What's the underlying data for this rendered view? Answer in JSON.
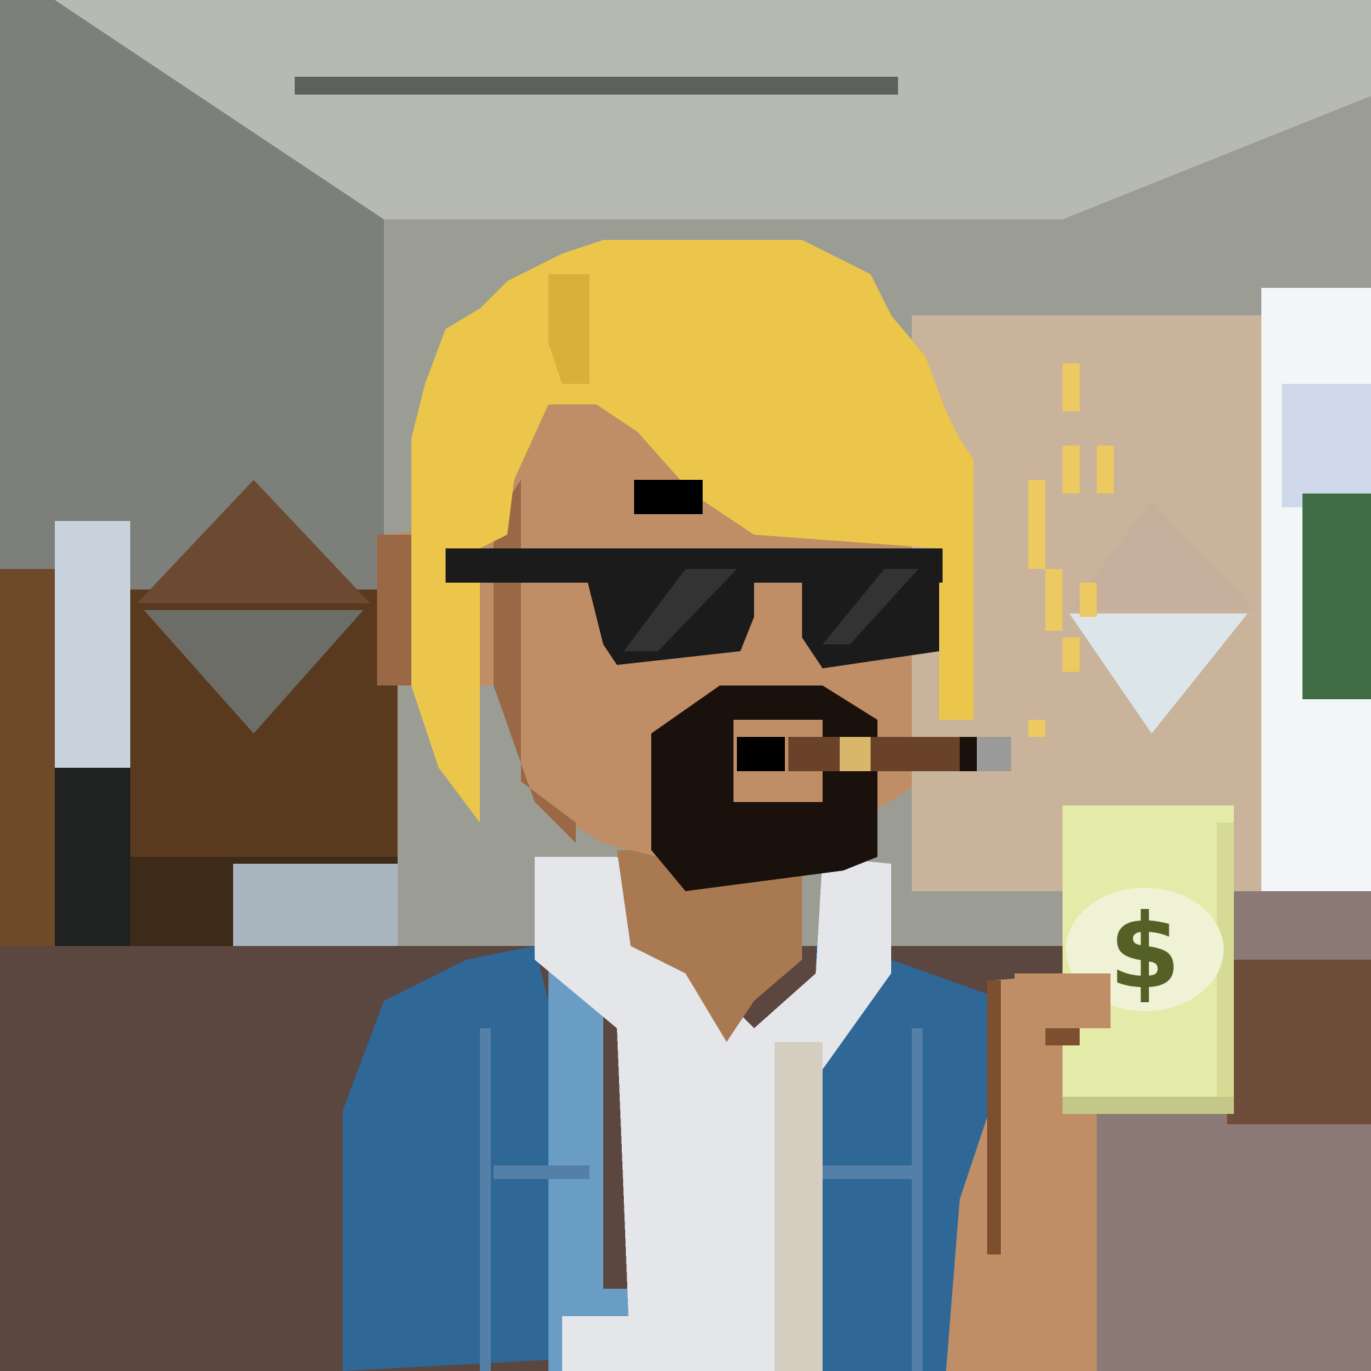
{
  "artwork": {
    "style": "pixel-art",
    "subject": "avatar",
    "background_scene": "room-interior-blurred",
    "held_item_symbol": "$",
    "colors": {
      "wall_gray": "#9b9d95",
      "ceiling_light": "#b9bdb6",
      "wall_dark": "#6f726c",
      "wood_brown": "#5a3a1e",
      "wood_dark": "#3e2a18",
      "floor_brown": "#5b4640",
      "window_white": "#f3f6f7",
      "window_blue": "#cfd9ea",
      "plant_green": "#3f6b45",
      "hair_yellow": "#ebc64a",
      "hair_shadow": "#d8b13a",
      "skin": "#bf8e66",
      "skin_shadow": "#9a6845",
      "skin_dark": "#7d4f2e",
      "glasses_black": "#1b1b1b",
      "glasses_shine": "#333333",
      "beard": "#1a110c",
      "cigar": "#6a4129",
      "cigar_band": "#d9b76a",
      "cigar_ash": "#9a9a9a",
      "shirt_white": "#e4e6ea",
      "shirt_shadow": "#d5cdc0",
      "jacket_blue": "#2f6796",
      "jacket_light": "#6a9dc4",
      "jacket_seam": "#5480a8",
      "money_yellow": "#e4eaa8",
      "money_light": "#f0f2d6",
      "money_symbol": "#556026"
    }
  }
}
